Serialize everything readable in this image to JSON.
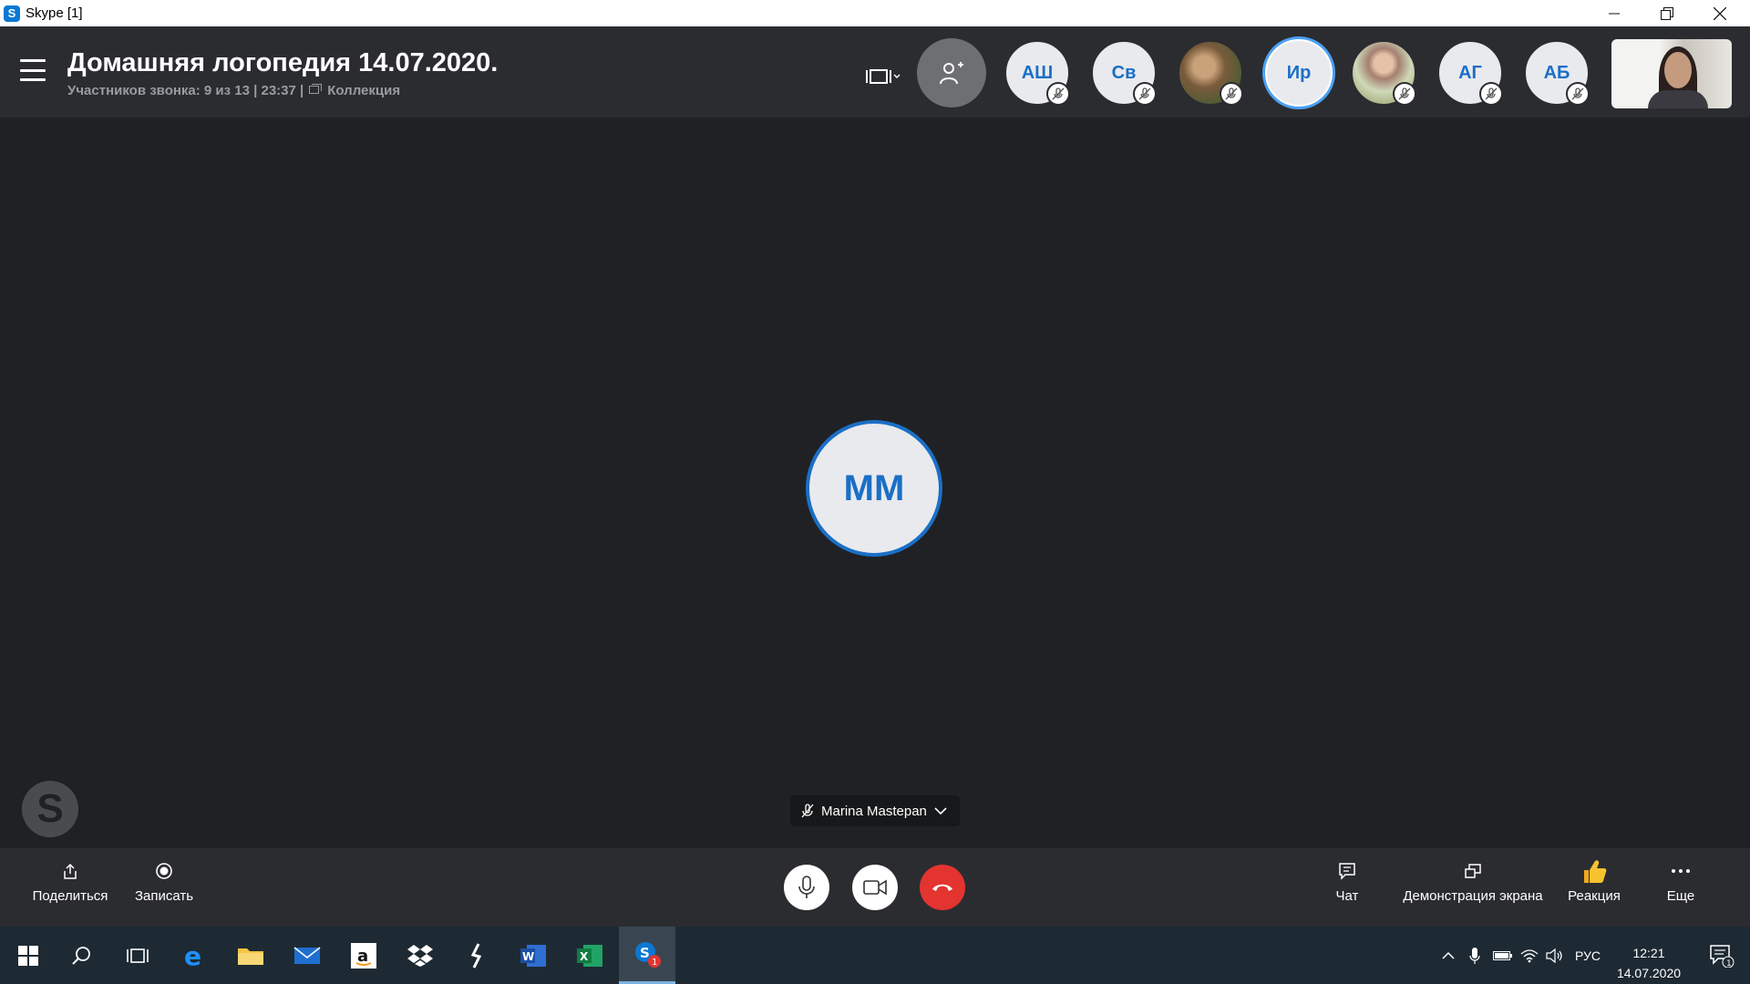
{
  "window": {
    "title": "Skype [1]",
    "app_icon_letter": "S"
  },
  "header": {
    "title": "Домашняя логопедия 14.07.2020.",
    "participants_info": "Участников звонка: 9 из 13 | 23:37 |",
    "gallery_label": "Коллекция",
    "participants": [
      {
        "initials": "АШ",
        "muted": true
      },
      {
        "initials": "Св",
        "muted": true
      },
      {
        "initials": "",
        "muted": true
      },
      {
        "initials": "Ир",
        "muted": false
      },
      {
        "initials": "",
        "muted": true
      },
      {
        "initials": "АГ",
        "muted": true
      },
      {
        "initials": "АБ",
        "muted": true
      }
    ]
  },
  "stage": {
    "main_initials": "ММ",
    "speaker_name": "Marina Mastepan",
    "watermark_letter": "S"
  },
  "toolbar": {
    "share_label": "Поделиться",
    "record_label": "Записать",
    "chat_label": "Чат",
    "screen_share_label": "Демонстрация экрана",
    "reaction_label": "Реакция",
    "more_label": "Еще"
  },
  "taskbar": {
    "lang": "РУС",
    "time": "12:21",
    "date": "14.07.2020",
    "skype_badge": "1",
    "notifications_badge": "1"
  },
  "colors": {
    "accent": "#1a6fc6",
    "hangup": "#e3342f",
    "header_bg": "#2b2c30",
    "stage_bg": "#202124"
  }
}
